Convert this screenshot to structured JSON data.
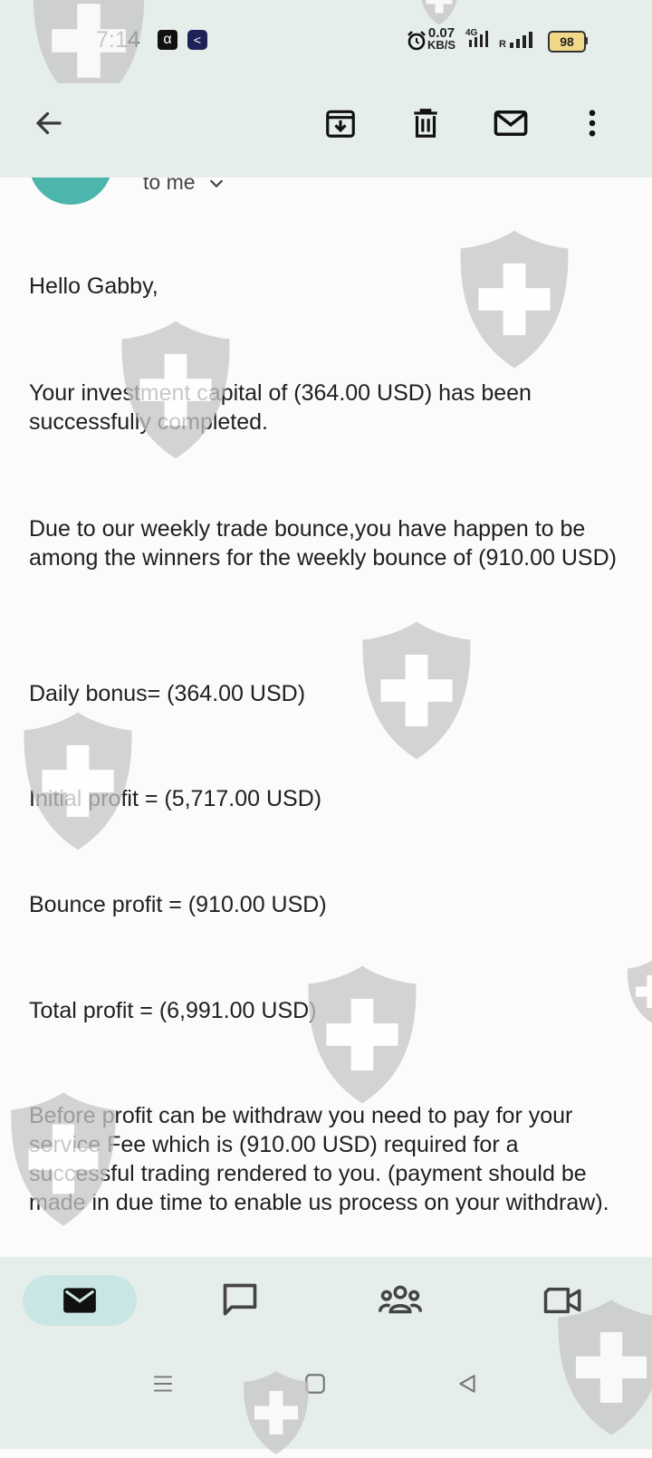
{
  "status_bar": {
    "time": "7:14",
    "badge_1": "α",
    "badge_2": "<",
    "net_speed_value": "0.07",
    "net_speed_unit": "KB/S",
    "network_type": "4G",
    "sim2_label": "R",
    "battery_level": "98",
    "icons": [
      "alarm-icon",
      "signal-icon",
      "battery-icon"
    ]
  },
  "app_bar": {
    "icons": [
      "back-arrow-icon",
      "archive-icon",
      "delete-icon",
      "mark-unread-icon",
      "more-vert-icon"
    ]
  },
  "header": {
    "recipient_label": "to me"
  },
  "message": {
    "greeting": "Hello Gabby,",
    "p1": "Your investment capital of (364.00 USD) has been successfully completed.",
    "p2": "Due to our weekly trade bounce,you have happen to be among the winners for the weekly bounce of (910.00 USD)",
    "daily_bonus": "Daily bonus= (364.00 USD)",
    "initial_profit": "Initial profit = (5,717.00 USD)",
    "bounce_profit": "Bounce profit = (910.00 USD)",
    "total_profit": "Total profit = (6,991.00 USD)",
    "p3": "Before profit can be withdraw you need to pay for your service Fee which is (910.00 USD) required for a successful trading rendered to you. (payment should be made in due time to enable us process on your withdraw)."
  },
  "bottom_nav": {
    "items": [
      "mail-icon",
      "chat-icon",
      "spaces-icon",
      "meet-icon"
    ],
    "active": "mail-icon"
  },
  "system_nav": [
    "menu-icon",
    "home-icon",
    "back-icon"
  ],
  "colors": {
    "bar_background": "#e6eeeb",
    "content_background": "#fbfbfb",
    "avatar": "#4db6ac",
    "active_nav_pill": "#c9e6e5",
    "watermark": "#c8c8c8"
  }
}
